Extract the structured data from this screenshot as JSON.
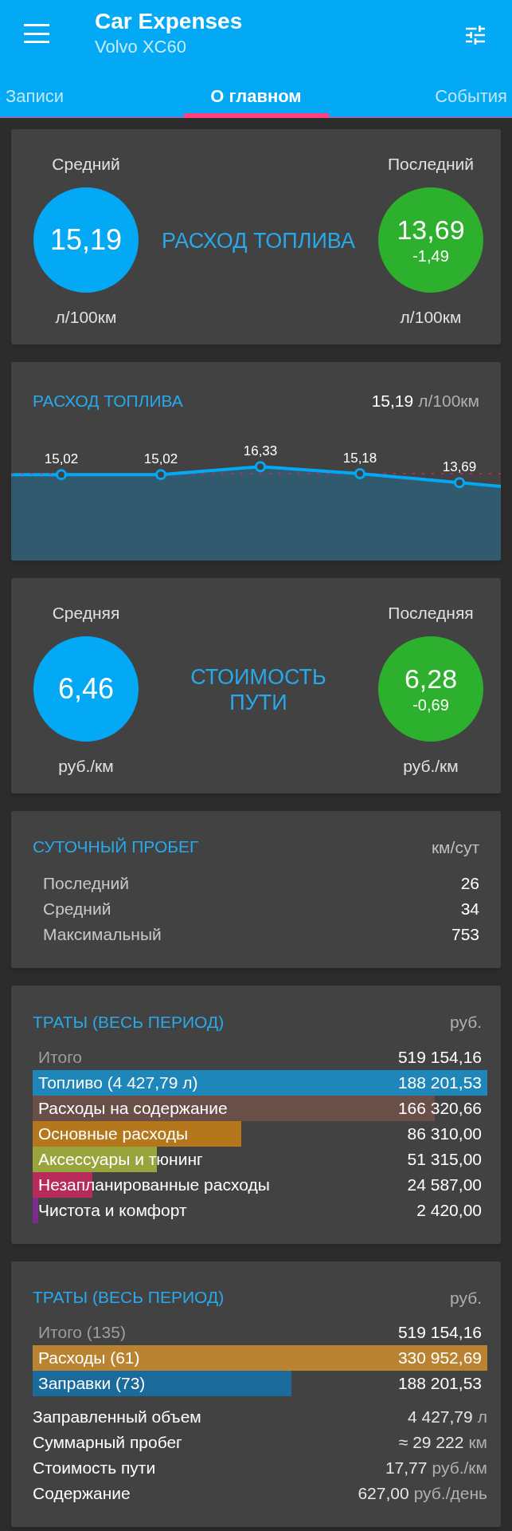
{
  "app_bar": {
    "title": "Car Expenses",
    "subtitle": "Volvo XC60"
  },
  "tabs": [
    {
      "label": "Записи",
      "selected": false
    },
    {
      "label": "О главном",
      "selected": true
    },
    {
      "label": "События",
      "selected": false
    }
  ],
  "fuel_summary": {
    "title_lines": [
      "РАСХОД ТОПЛИВА"
    ],
    "gauges": [
      {
        "label": "Средний",
        "value": "15,19",
        "unit": "л/100км",
        "color": "#03a9f4"
      },
      {
        "label": "Последний",
        "value": "13,69",
        "delta": "-1,49",
        "unit": "л/100км",
        "color": "#2db02d"
      }
    ]
  },
  "fuel_chart": {
    "title": "РАСХОД ТОПЛИВА",
    "value": "15,19",
    "unit": "л/100км",
    "point_labels": [
      "15,02",
      "15,02",
      "16,33",
      "15,18",
      "13,69"
    ]
  },
  "cost_summary": {
    "title_lines": [
      "СТОИМОСТЬ",
      "ПУТИ"
    ],
    "gauges": [
      {
        "label": "Средняя",
        "value": "6,46",
        "unit": "руб./км",
        "color": "#03a9f4"
      },
      {
        "label": "Последняя",
        "value": "6,28",
        "delta": "-0,69",
        "unit": "руб./км",
        "color": "#2db02d"
      }
    ]
  },
  "daily_mileage": {
    "title": "СУТОЧНЫЙ ПРОБЕГ",
    "unit": "км/сут",
    "rows": [
      {
        "label": "Последний",
        "value": "26"
      },
      {
        "label": "Средний",
        "value": "34"
      },
      {
        "label": "Максимальный",
        "value": "753"
      }
    ]
  },
  "expenses_by_category": {
    "title": "ТРАТЫ (ВЕСЬ ПЕРИОД)",
    "unit": "руб.",
    "total": {
      "label": "Итого",
      "value": "519 154,16"
    },
    "rows": [
      {
        "label": "Топливо (4 427,79 л)",
        "value": "188 201,53",
        "color": "#1e86b8"
      },
      {
        "label": "Расходы на содержание",
        "value": "166 320,66",
        "color": "#6a4e48"
      },
      {
        "label": "Основные расходы",
        "value": "86 310,00",
        "color": "#b5771c"
      },
      {
        "label": "Аксессуары и тюнинг",
        "value": "51 315,00",
        "color": "#9aa43c"
      },
      {
        "label": "Незапланированные расходы",
        "value": "24 587,00",
        "color": "#b62b5b"
      },
      {
        "label": "Чистота и комфорт",
        "value": "2 420,00",
        "color": "#7b2d8e"
      }
    ]
  },
  "expenses_by_type": {
    "title": "ТРАТЫ (ВЕСЬ ПЕРИОД)",
    "unit": "руб.",
    "total": {
      "label": "Итого (135)",
      "value": "519 154,16"
    },
    "rows": [
      {
        "label": "Расходы (61)",
        "value": "330 952,69",
        "color": "#b98332"
      },
      {
        "label": "Заправки (73)",
        "value": "188 201,53",
        "color": "#1a6a9b"
      }
    ],
    "stats": [
      {
        "label": "Заправленный объем",
        "value": "4 427,79",
        "unit": "л"
      },
      {
        "label": "Суммарный пробег",
        "value": "≈ 29 222",
        "unit": "км"
      },
      {
        "label": "Стоимость пути",
        "value": "17,77",
        "unit": "руб./км"
      },
      {
        "label": "Содержание",
        "value": "627,00",
        "unit": "руб./день"
      }
    ]
  }
}
